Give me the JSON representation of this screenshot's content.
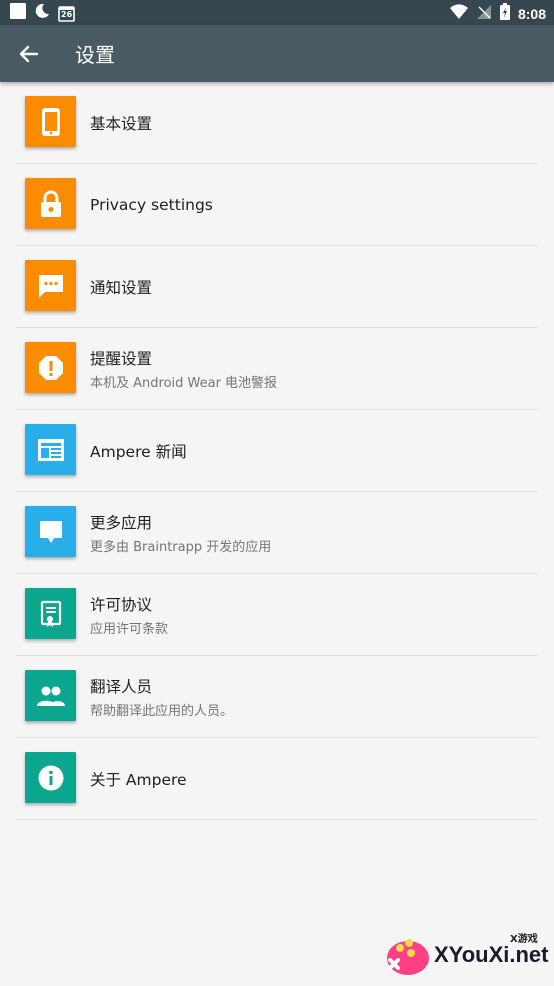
{
  "status_bar": {
    "time": "8:08",
    "calendar_day": "26"
  },
  "app_bar": {
    "title": "设置"
  },
  "items": [
    {
      "title": "基本设置",
      "subtitle": "",
      "icon": "phone-icon",
      "color": "#fb8c00"
    },
    {
      "title": "Privacy settings",
      "subtitle": "",
      "icon": "lock-icon",
      "color": "#fb8c00"
    },
    {
      "title": "通知设置",
      "subtitle": "",
      "icon": "chat-bubble-icon",
      "color": "#fb8c00"
    },
    {
      "title": "提醒设置",
      "subtitle": "本机及 Android Wear 电池警报",
      "icon": "alert-octagon-icon",
      "color": "#fb8c00"
    },
    {
      "title": "Ampere 新闻",
      "subtitle": "",
      "icon": "news-icon",
      "color": "#29aee9"
    },
    {
      "title": "更多应用",
      "subtitle": "更多由 Braintrapp 开发的应用",
      "icon": "message-icon",
      "color": "#29aee9"
    },
    {
      "title": "许可协议",
      "subtitle": "应用许可条款",
      "icon": "certificate-icon",
      "color": "#0aa68d"
    },
    {
      "title": "翻译人员",
      "subtitle": "帮助翻译此应用的人员。",
      "icon": "people-icon",
      "color": "#0aa68d"
    },
    {
      "title": "关于 Ampere",
      "subtitle": "",
      "icon": "info-icon",
      "color": "#0aa68d"
    }
  ],
  "watermark": {
    "text": "XYouXi.net",
    "small": "X游戏"
  }
}
